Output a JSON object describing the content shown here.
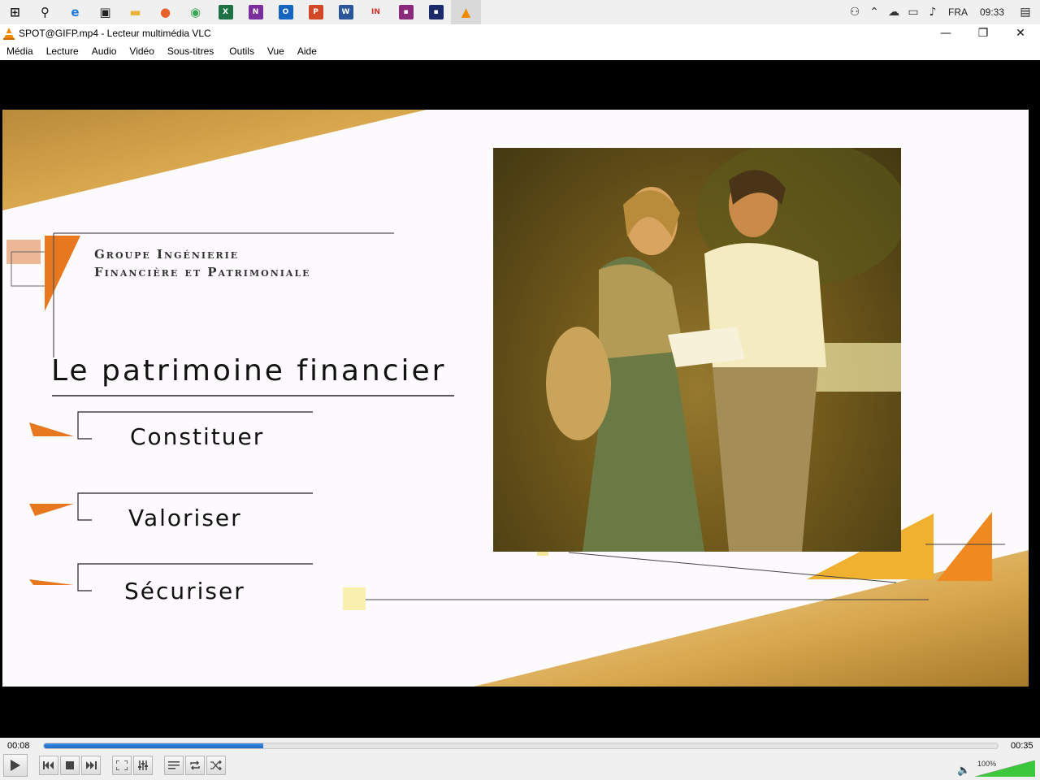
{
  "taskbar": {
    "icons": [
      {
        "name": "windows-start-icon",
        "glyph": "⊞",
        "color": "#1a1a1a"
      },
      {
        "name": "search-icon",
        "glyph": "⚲",
        "color": "#1a1a1a"
      },
      {
        "name": "edge-icon",
        "glyph": "e",
        "color": "#1e78d6"
      },
      {
        "name": "store-icon",
        "glyph": "▣",
        "color": "#222222"
      },
      {
        "name": "file-explorer-icon",
        "glyph": "▬",
        "color": "#e8b53a"
      },
      {
        "name": "firefox-icon",
        "glyph": "●",
        "color": "#e8622a"
      },
      {
        "name": "chrome-icon",
        "glyph": "◉",
        "color": "#3aa757"
      },
      {
        "name": "excel-icon",
        "glyph": "X",
        "color": "#1e7145"
      },
      {
        "name": "onenote-icon",
        "glyph": "N",
        "color": "#7b2f9e"
      },
      {
        "name": "outlook-icon",
        "glyph": "O",
        "color": "#1565c0"
      },
      {
        "name": "powerpoint-icon",
        "glyph": "P",
        "color": "#d24726"
      },
      {
        "name": "word-icon",
        "glyph": "W",
        "color": "#2b579a"
      },
      {
        "name": "in-app-icon",
        "glyph": "IN",
        "color": "#ffffff"
      },
      {
        "name": "purple-app-icon",
        "glyph": "▪",
        "color": "#8a2a7a"
      },
      {
        "name": "navy-app-icon",
        "glyph": "▪",
        "color": "#1b2a6b"
      },
      {
        "name": "vlc-icon",
        "glyph": "▲",
        "color": "#f08a00"
      }
    ],
    "tray": {
      "language": "FRA",
      "clock": "09:33"
    }
  },
  "window": {
    "title": "SPOT@GIFP.mp4 - Lecteur multimédia VLC"
  },
  "menu": [
    "Média",
    "Lecture",
    "Audio",
    "Vidéo",
    "Sous-titres",
    "Outils",
    "Vue",
    "Aide"
  ],
  "video": {
    "brand_line1": "Groupe Ingénierie",
    "brand_line2": "Financière et Patrimoniale",
    "headline": "Le patrimoine financier",
    "items": [
      "Constituer",
      "Valoriser",
      "Sécuriser"
    ]
  },
  "player": {
    "elapsed": "00:08",
    "total": "00:35",
    "progress": 0.23,
    "volume": "100%",
    "volume_level": 1.0
  }
}
